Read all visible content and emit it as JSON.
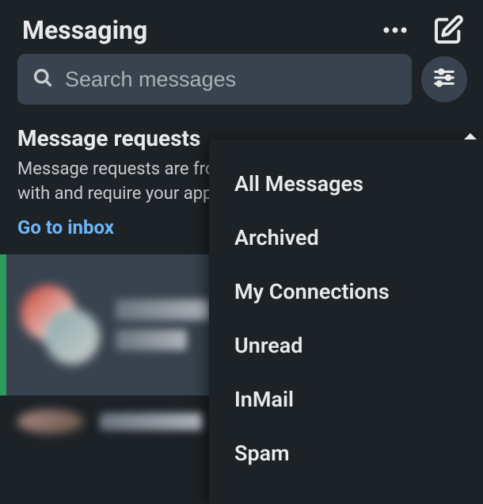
{
  "header": {
    "title": "Messaging"
  },
  "search": {
    "placeholder": "Search messages"
  },
  "requests": {
    "title": "Message requests",
    "description": "Message requests are from people you're not connected with and require your approval.",
    "go_inbox": "Go to inbox"
  },
  "filter_menu": {
    "items": [
      "All Messages",
      "Archived",
      "My Connections",
      "Unread",
      "InMail",
      "Spam"
    ]
  }
}
